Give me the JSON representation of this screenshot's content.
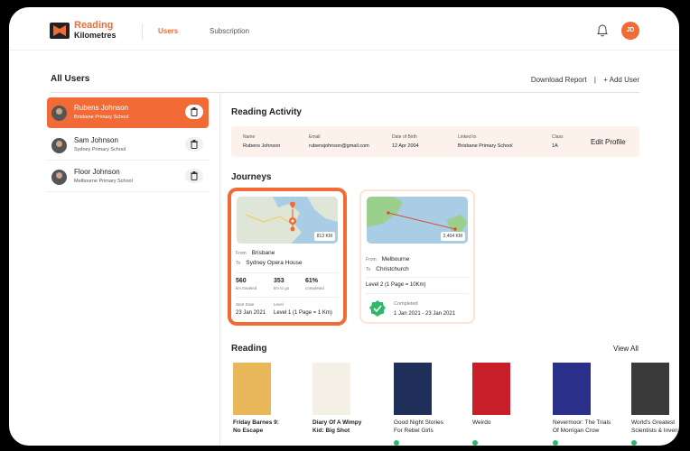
{
  "brand": {
    "line1": "Reading",
    "line2": "Kilometres"
  },
  "nav": {
    "users": "Users",
    "subscription": "Subscription"
  },
  "profile": {
    "initials": "JD"
  },
  "page": {
    "title": "All Users",
    "download": "Download Report",
    "separator": "|",
    "add_user": "+ Add User"
  },
  "users": [
    {
      "name": "Rubens Johnson",
      "school": "Brisbane Primary School",
      "active": true
    },
    {
      "name": "Sam Johnson",
      "school": "Sydney Primary School",
      "active": false
    },
    {
      "name": "Floor Johnson",
      "school": "Melbourne Primary School",
      "active": false
    }
  ],
  "activity": {
    "title": "Reading Activity",
    "fields": [
      {
        "label": "Name",
        "value": "Rubens Johnson"
      },
      {
        "label": "Email",
        "value": "rubensjohnson@gmail.com"
      },
      {
        "label": "Date of Birth",
        "value": "12 Apr 2004"
      },
      {
        "label": "Linked to",
        "value": "Brisbane Primary School"
      },
      {
        "label": "Class",
        "value": "1A"
      }
    ],
    "edit": "Edit Profile"
  },
  "journeys": {
    "title": "Journeys",
    "cards": [
      {
        "distance": "813 KM",
        "from_label": "From",
        "from": "Brisbane",
        "to_label": "To",
        "to": "Sydney Opera House",
        "stats": [
          {
            "value": "560",
            "label": "km traveled"
          },
          {
            "value": "353",
            "label": "km to go"
          },
          {
            "value": "61%",
            "label": "completed"
          }
        ],
        "start_label": "Start Date",
        "start": "23 Jan 2021",
        "level_label": "Level",
        "level": "Level 1 (1 Page = 1 Km)"
      },
      {
        "distance": "2,404 KM",
        "from_label": "From",
        "from": "Melbourne",
        "to_label": "To",
        "to": "Christchurch",
        "level": "Level 2 (1 Page = 10Km)",
        "status": "Completed",
        "dates": "1 Jan 2021 - 23 Jan 2021"
      }
    ]
  },
  "reading": {
    "title": "Reading",
    "view_all": "View All",
    "books": [
      {
        "title1": "Friday Barnes 9:",
        "title2": "No Escape",
        "cover": "#e8b75a",
        "bold": true
      },
      {
        "title1": "Diary Of A Wimpy",
        "title2": "Kid: Big Shot",
        "cover": "#f5f0e6",
        "bold": true
      },
      {
        "title1": "Good Night Stories",
        "title2": "For Rebel Girls",
        "cover": "#1f2f5a",
        "bold": false
      },
      {
        "title1": "Weirdo",
        "title2": "",
        "cover": "#c81e2a",
        "bold": false
      },
      {
        "title1": "Nevermoor: The Trials",
        "title2": "Of Morrigan Crow",
        "cover": "#2a2f8a",
        "bold": false
      },
      {
        "title1": "World's Greatest",
        "title2": "Scientists & Inven",
        "cover": "#3a3a3a",
        "bold": false
      }
    ]
  },
  "colors": {
    "accent": "#f26a36",
    "accent_light": "#fdf1ec",
    "success": "#2fb86b"
  }
}
